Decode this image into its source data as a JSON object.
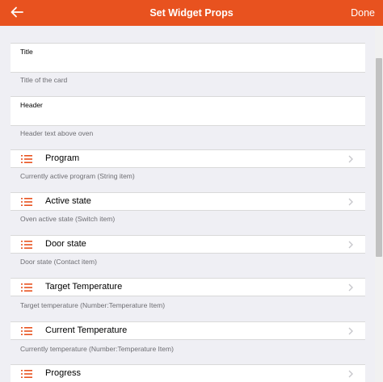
{
  "navbar": {
    "title": "Set Widget Props",
    "done_label": "Done",
    "back_icon": "arrow-left-icon",
    "background_color": "#e8521f"
  },
  "fields": [
    {
      "label": "Title",
      "value": "",
      "helper": "Title of the card"
    },
    {
      "label": "Header",
      "value": "",
      "helper": "Header text above oven"
    }
  ],
  "items": [
    {
      "label": "Program",
      "helper": "Currently active program (String item)",
      "icon": "list-icon"
    },
    {
      "label": "Active state",
      "helper": "Oven active state (Switch item)",
      "icon": "list-icon"
    },
    {
      "label": "Door state",
      "helper": "Door state (Contact item)",
      "icon": "list-icon"
    },
    {
      "label": "Target Temperature",
      "helper": "Target temperature (Number:Temperature Item)",
      "icon": "list-icon"
    },
    {
      "label": "Current Temperature",
      "helper": "Currently temperature (Number:Temperature Item)",
      "icon": "list-icon"
    },
    {
      "label": "Progress",
      "helper": "",
      "icon": "list-icon"
    }
  ],
  "accent_color": "#e8521f"
}
